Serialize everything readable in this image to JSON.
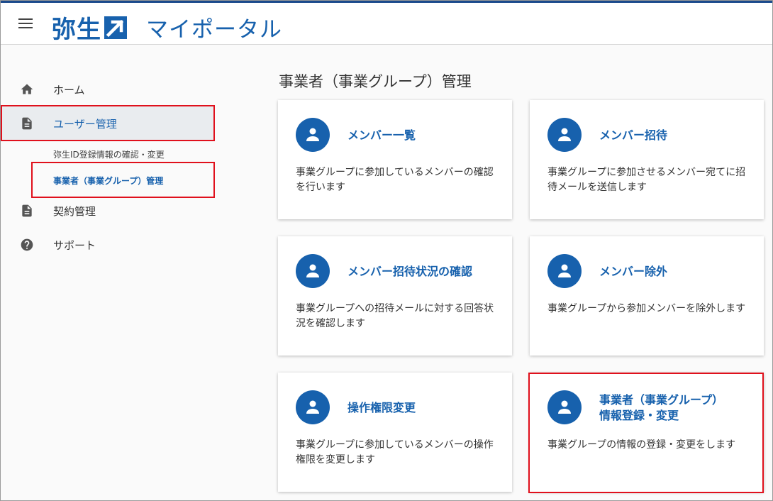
{
  "header": {
    "logo_text": "弥生",
    "portal_title": "マイポータル"
  },
  "sidebar": {
    "items": [
      {
        "label": "ホーム",
        "icon": "home-icon"
      },
      {
        "label": "ユーザー管理",
        "icon": "document-icon"
      },
      {
        "label": "契約管理",
        "icon": "document-icon"
      },
      {
        "label": "サポート",
        "icon": "help-icon"
      }
    ],
    "sub_items": [
      {
        "label": "弥生ID登録情報の確認・変更"
      },
      {
        "label": "事業者（事業グループ）管理"
      }
    ]
  },
  "main": {
    "title": "事業者（事業グループ）管理",
    "cards": [
      {
        "title": "メンバー一覧",
        "desc": "事業グループに参加しているメンバーの確認を行います"
      },
      {
        "title": "メンバー招待",
        "desc": "事業グループに参加させるメンバー宛てに招待メールを送信します"
      },
      {
        "title": "メンバー招待状況の確認",
        "desc": "事業グループへの招待メールに対する回答状況を確認します"
      },
      {
        "title": "メンバー除外",
        "desc": "事業グループから参加メンバーを除外します"
      },
      {
        "title": "操作権限変更",
        "desc": "事業グループに参加しているメンバーの操作権限を変更します"
      },
      {
        "title": "事業者（事業グループ）\n情報登録・変更",
        "desc": "事業グループの情報の登録・変更をします"
      }
    ]
  },
  "colors": {
    "brand": "#1761ad",
    "highlight": "#e0101c",
    "header_border": "#1b4a8c"
  }
}
